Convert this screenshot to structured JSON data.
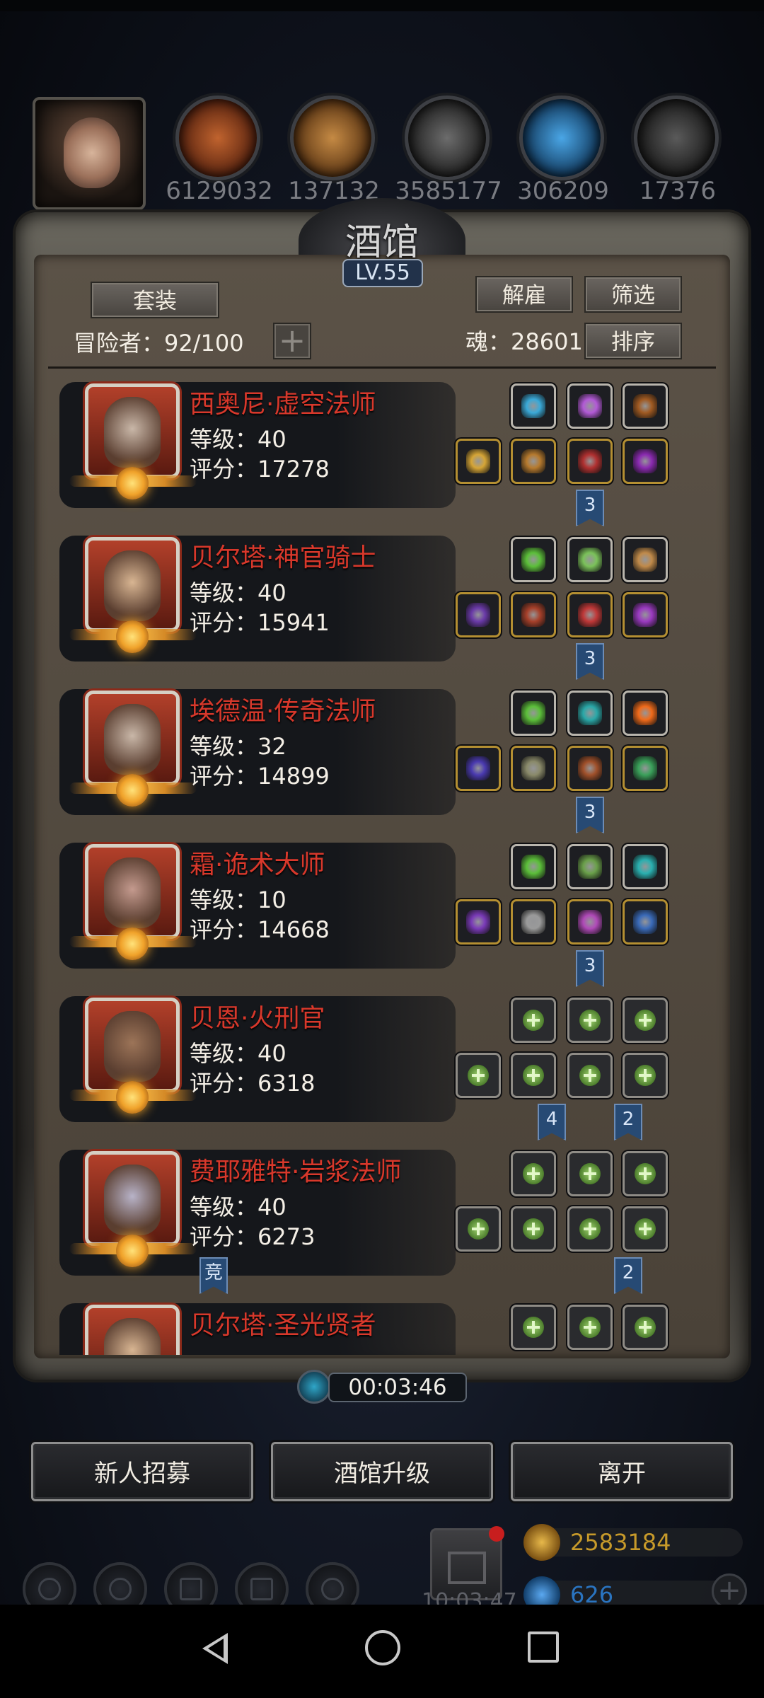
{
  "resources": [
    {
      "icon": "meat-icon",
      "value": "6129032",
      "color": "#9c4a22"
    },
    {
      "icon": "wood-icon",
      "value": "137132",
      "color": "#b07030"
    },
    {
      "icon": "stone-icon",
      "value": "3585177",
      "color": "#5a5a5a"
    },
    {
      "icon": "crystal-icon",
      "value": "306209",
      "color": "#2a79b8"
    },
    {
      "icon": "iron-icon",
      "value": "17376",
      "color": "#4b4b4b"
    }
  ],
  "panel": {
    "title": "酒馆",
    "level": "LV.55",
    "set_button": "套装",
    "dismiss_button": "解雇",
    "filter_button": "筛选",
    "sort_button": "排序",
    "adventurer_label": "冒险者：92/100",
    "soul_label": "魂：28601"
  },
  "heroes": [
    {
      "name": "西奥尼·虚空法师",
      "level": "等级：40",
      "score": "评分：17278",
      "face": "#c9b7a8",
      "badge": "3",
      "slots_top": [
        "#3aa9d8",
        "#b25ad6",
        "#a05a22"
      ],
      "slots_bottom": [
        "#d6a536",
        "#b67a2e",
        "#b03030",
        "#8a2ab0"
      ],
      "type": "gear"
    },
    {
      "name": "贝尔塔·神官骑士",
      "level": "等级：40",
      "score": "评分：15941",
      "face": "#d8b592",
      "badge": "3",
      "slots_top": [
        "#5cbf3a",
        "#7bc25a",
        "#c08a4a"
      ],
      "slots_bottom": [
        "#6a3aa8",
        "#a6402a",
        "#c03838",
        "#9a3ac0"
      ],
      "type": "gear"
    },
    {
      "name": "埃德温·传奇法师",
      "level": "等级：32",
      "score": "评分：14899",
      "face": "#c9b7a8",
      "badge": "3",
      "slots_top": [
        "#5cbf3a",
        "#2aa8a8",
        "#f06a1a"
      ],
      "slots_bottom": [
        "#4a3ab0",
        "#8a8a6a",
        "#a0502a",
        "#3aa05a"
      ],
      "type": "gear"
    },
    {
      "name": "霜·诡术大师",
      "level": "等级：10",
      "score": "评分：14668",
      "face": "#c49a8e",
      "badge": "3",
      "slots_top": [
        "#5cbf3a",
        "#6aa04a",
        "#2ab0b0"
      ],
      "slots_bottom": [
        "#7a3ab8",
        "#9a9a9a",
        "#b04ab8",
        "#3a6ab8"
      ],
      "type": "gear"
    },
    {
      "name": "贝恩·火刑官",
      "level": "等级：40",
      "score": "评分：6318",
      "face": "#9c7458",
      "badges": [
        "4",
        "2"
      ],
      "type": "empty"
    },
    {
      "name": "费耶雅特·岩浆法师",
      "level": "等级：40",
      "score": "评分：6273",
      "face": "#b8b3c8",
      "badges": [
        "竞",
        "2"
      ],
      "type": "empty"
    },
    {
      "name": "贝尔塔·圣光贤者",
      "level": "",
      "score": "",
      "face": "#d8b592",
      "type": "empty-partial"
    }
  ],
  "timer": "00:03:46",
  "actions": {
    "recruit": "新人招募",
    "upgrade": "酒馆升级",
    "leave": "离开"
  },
  "hud": {
    "clock": "10:03:47",
    "gold": {
      "value": "2583184",
      "color": "#c79a2a"
    },
    "gems": {
      "value": "626",
      "color": "#2a74c0"
    }
  }
}
